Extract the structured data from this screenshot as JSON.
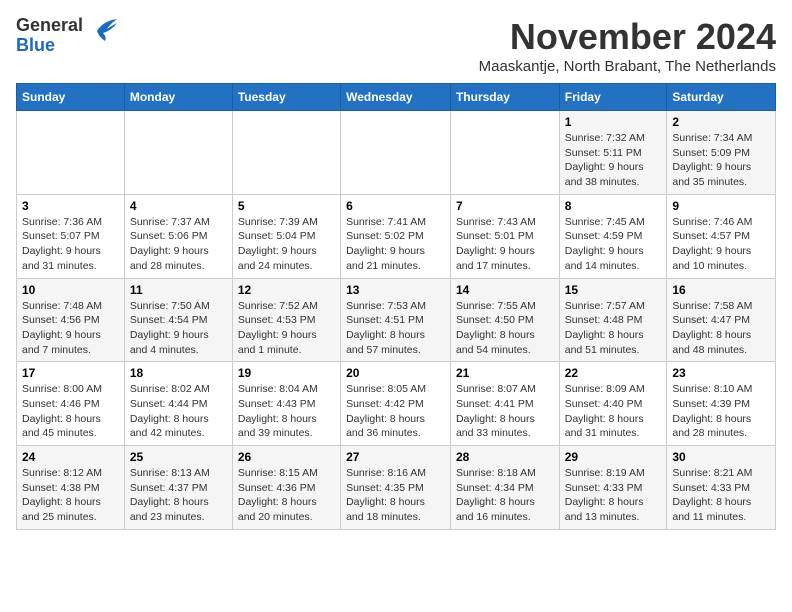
{
  "logo": {
    "general": "General",
    "blue": "Blue"
  },
  "title": "November 2024",
  "subtitle": "Maaskantje, North Brabant, The Netherlands",
  "days_of_week": [
    "Sunday",
    "Monday",
    "Tuesday",
    "Wednesday",
    "Thursday",
    "Friday",
    "Saturday"
  ],
  "weeks": [
    [
      {
        "day": "",
        "info": ""
      },
      {
        "day": "",
        "info": ""
      },
      {
        "day": "",
        "info": ""
      },
      {
        "day": "",
        "info": ""
      },
      {
        "day": "",
        "info": ""
      },
      {
        "day": "1",
        "info": "Sunrise: 7:32 AM\nSunset: 5:11 PM\nDaylight: 9 hours and 38 minutes."
      },
      {
        "day": "2",
        "info": "Sunrise: 7:34 AM\nSunset: 5:09 PM\nDaylight: 9 hours and 35 minutes."
      }
    ],
    [
      {
        "day": "3",
        "info": "Sunrise: 7:36 AM\nSunset: 5:07 PM\nDaylight: 9 hours and 31 minutes."
      },
      {
        "day": "4",
        "info": "Sunrise: 7:37 AM\nSunset: 5:06 PM\nDaylight: 9 hours and 28 minutes."
      },
      {
        "day": "5",
        "info": "Sunrise: 7:39 AM\nSunset: 5:04 PM\nDaylight: 9 hours and 24 minutes."
      },
      {
        "day": "6",
        "info": "Sunrise: 7:41 AM\nSunset: 5:02 PM\nDaylight: 9 hours and 21 minutes."
      },
      {
        "day": "7",
        "info": "Sunrise: 7:43 AM\nSunset: 5:01 PM\nDaylight: 9 hours and 17 minutes."
      },
      {
        "day": "8",
        "info": "Sunrise: 7:45 AM\nSunset: 4:59 PM\nDaylight: 9 hours and 14 minutes."
      },
      {
        "day": "9",
        "info": "Sunrise: 7:46 AM\nSunset: 4:57 PM\nDaylight: 9 hours and 10 minutes."
      }
    ],
    [
      {
        "day": "10",
        "info": "Sunrise: 7:48 AM\nSunset: 4:56 PM\nDaylight: 9 hours and 7 minutes."
      },
      {
        "day": "11",
        "info": "Sunrise: 7:50 AM\nSunset: 4:54 PM\nDaylight: 9 hours and 4 minutes."
      },
      {
        "day": "12",
        "info": "Sunrise: 7:52 AM\nSunset: 4:53 PM\nDaylight: 9 hours and 1 minute."
      },
      {
        "day": "13",
        "info": "Sunrise: 7:53 AM\nSunset: 4:51 PM\nDaylight: 8 hours and 57 minutes."
      },
      {
        "day": "14",
        "info": "Sunrise: 7:55 AM\nSunset: 4:50 PM\nDaylight: 8 hours and 54 minutes."
      },
      {
        "day": "15",
        "info": "Sunrise: 7:57 AM\nSunset: 4:48 PM\nDaylight: 8 hours and 51 minutes."
      },
      {
        "day": "16",
        "info": "Sunrise: 7:58 AM\nSunset: 4:47 PM\nDaylight: 8 hours and 48 minutes."
      }
    ],
    [
      {
        "day": "17",
        "info": "Sunrise: 8:00 AM\nSunset: 4:46 PM\nDaylight: 8 hours and 45 minutes."
      },
      {
        "day": "18",
        "info": "Sunrise: 8:02 AM\nSunset: 4:44 PM\nDaylight: 8 hours and 42 minutes."
      },
      {
        "day": "19",
        "info": "Sunrise: 8:04 AM\nSunset: 4:43 PM\nDaylight: 8 hours and 39 minutes."
      },
      {
        "day": "20",
        "info": "Sunrise: 8:05 AM\nSunset: 4:42 PM\nDaylight: 8 hours and 36 minutes."
      },
      {
        "day": "21",
        "info": "Sunrise: 8:07 AM\nSunset: 4:41 PM\nDaylight: 8 hours and 33 minutes."
      },
      {
        "day": "22",
        "info": "Sunrise: 8:09 AM\nSunset: 4:40 PM\nDaylight: 8 hours and 31 minutes."
      },
      {
        "day": "23",
        "info": "Sunrise: 8:10 AM\nSunset: 4:39 PM\nDaylight: 8 hours and 28 minutes."
      }
    ],
    [
      {
        "day": "24",
        "info": "Sunrise: 8:12 AM\nSunset: 4:38 PM\nDaylight: 8 hours and 25 minutes."
      },
      {
        "day": "25",
        "info": "Sunrise: 8:13 AM\nSunset: 4:37 PM\nDaylight: 8 hours and 23 minutes."
      },
      {
        "day": "26",
        "info": "Sunrise: 8:15 AM\nSunset: 4:36 PM\nDaylight: 8 hours and 20 minutes."
      },
      {
        "day": "27",
        "info": "Sunrise: 8:16 AM\nSunset: 4:35 PM\nDaylight: 8 hours and 18 minutes."
      },
      {
        "day": "28",
        "info": "Sunrise: 8:18 AM\nSunset: 4:34 PM\nDaylight: 8 hours and 16 minutes."
      },
      {
        "day": "29",
        "info": "Sunrise: 8:19 AM\nSunset: 4:33 PM\nDaylight: 8 hours and 13 minutes."
      },
      {
        "day": "30",
        "info": "Sunrise: 8:21 AM\nSunset: 4:33 PM\nDaylight: 8 hours and 11 minutes."
      }
    ]
  ]
}
